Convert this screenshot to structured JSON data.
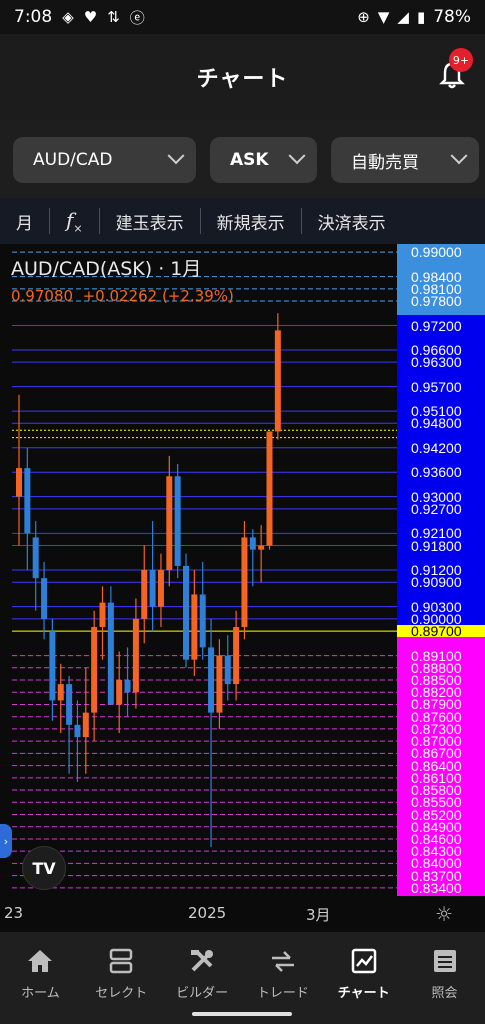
{
  "status": {
    "time": "7:08",
    "battery": "78%"
  },
  "header": {
    "title": "チャート",
    "badge": "9+"
  },
  "selectors": {
    "symbol": "AUD/CAD",
    "side": "ASK",
    "mode": "自動売買"
  },
  "toolbar": {
    "period": "月",
    "fx_label": "f",
    "items": [
      "建玉表示",
      "新規表示",
      "決済表示"
    ]
  },
  "chart_data": {
    "type": "candlestick",
    "title": "AUD/CAD(ASK) · 1月",
    "last_price": "0.97080",
    "change": "+0.02262 (+2.39%)",
    "ylim": [
      0.832,
      0.992
    ],
    "price_labels": [
      "0.99000",
      "0.98400",
      "0.98100",
      "0.97800",
      "0.97200",
      "0.96600",
      "0.96300",
      "0.95700",
      "0.95100",
      "0.94800",
      "0.94200",
      "0.93600",
      "0.93000",
      "0.92700",
      "0.92100",
      "0.91800",
      "0.91200",
      "0.90900",
      "0.90300",
      "0.90000",
      "0.89700",
      "0.89100",
      "0.88800",
      "0.88500",
      "0.88200",
      "0.87900",
      "0.87600",
      "0.87300",
      "0.87000",
      "0.86700",
      "0.86400",
      "0.86100",
      "0.85800",
      "0.85500",
      "0.85200",
      "0.84900",
      "0.84600",
      "0.84300",
      "0.84000",
      "0.83700",
      "0.83400"
    ],
    "candles": [
      {
        "o": 0.93,
        "h": 0.955,
        "l": 0.918,
        "c": 0.937
      },
      {
        "o": 0.937,
        "h": 0.942,
        "l": 0.912,
        "c": 0.921
      },
      {
        "o": 0.92,
        "h": 0.924,
        "l": 0.902,
        "c": 0.91
      },
      {
        "o": 0.91,
        "h": 0.914,
        "l": 0.895,
        "c": 0.9
      },
      {
        "o": 0.897,
        "h": 0.9,
        "l": 0.875,
        "c": 0.88
      },
      {
        "o": 0.88,
        "h": 0.889,
        "l": 0.872,
        "c": 0.884
      },
      {
        "o": 0.884,
        "h": 0.886,
        "l": 0.862,
        "c": 0.874
      },
      {
        "o": 0.874,
        "h": 0.88,
        "l": 0.86,
        "c": 0.871
      },
      {
        "o": 0.871,
        "h": 0.888,
        "l": 0.862,
        "c": 0.877
      },
      {
        "o": 0.877,
        "h": 0.902,
        "l": 0.87,
        "c": 0.898
      },
      {
        "o": 0.898,
        "h": 0.908,
        "l": 0.89,
        "c": 0.904
      },
      {
        "o": 0.904,
        "h": 0.908,
        "l": 0.88,
        "c": 0.879
      },
      {
        "o": 0.879,
        "h": 0.892,
        "l": 0.872,
        "c": 0.885
      },
      {
        "o": 0.885,
        "h": 0.893,
        "l": 0.876,
        "c": 0.882
      },
      {
        "o": 0.882,
        "h": 0.905,
        "l": 0.878,
        "c": 0.9
      },
      {
        "o": 0.9,
        "h": 0.918,
        "l": 0.894,
        "c": 0.912
      },
      {
        "o": 0.912,
        "h": 0.924,
        "l": 0.897,
        "c": 0.903
      },
      {
        "o": 0.903,
        "h": 0.916,
        "l": 0.898,
        "c": 0.912
      },
      {
        "o": 0.912,
        "h": 0.94,
        "l": 0.908,
        "c": 0.935
      },
      {
        "o": 0.935,
        "h": 0.938,
        "l": 0.91,
        "c": 0.913
      },
      {
        "o": 0.913,
        "h": 0.916,
        "l": 0.888,
        "c": 0.89
      },
      {
        "o": 0.89,
        "h": 0.912,
        "l": 0.886,
        "c": 0.906
      },
      {
        "o": 0.906,
        "h": 0.914,
        "l": 0.89,
        "c": 0.893
      },
      {
        "o": 0.893,
        "h": 0.9,
        "l": 0.844,
        "c": 0.877
      },
      {
        "o": 0.877,
        "h": 0.895,
        "l": 0.873,
        "c": 0.891
      },
      {
        "o": 0.891,
        "h": 0.896,
        "l": 0.88,
        "c": 0.884
      },
      {
        "o": 0.884,
        "h": 0.902,
        "l": 0.88,
        "c": 0.898
      },
      {
        "o": 0.898,
        "h": 0.924,
        "l": 0.895,
        "c": 0.92
      },
      {
        "o": 0.92,
        "h": 0.922,
        "l": 0.908,
        "c": 0.917
      },
      {
        "o": 0.917,
        "h": 0.923,
        "l": 0.909,
        "c": 0.918
      },
      {
        "o": 0.918,
        "h": 0.946,
        "l": 0.917,
        "c": 0.946
      },
      {
        "o": 0.946,
        "h": 0.975,
        "l": 0.944,
        "c": 0.9708
      }
    ],
    "x_ticks": [
      "23",
      "2025",
      "3月"
    ],
    "colors": {
      "up": "#f26522",
      "down": "#2f7fd6"
    }
  },
  "nav": [
    {
      "label": "ホーム",
      "icon": "home-icon"
    },
    {
      "label": "セレクト",
      "icon": "select-icon"
    },
    {
      "label": "ビルダー",
      "icon": "builder-icon"
    },
    {
      "label": "トレード",
      "icon": "trade-icon"
    },
    {
      "label": "チャート",
      "icon": "chart-icon"
    },
    {
      "label": "照会",
      "icon": "list-icon"
    }
  ],
  "colors": {
    "blue_zone": "#0000ee",
    "magenta_zone": "#ff00ff",
    "current": "#ffff00",
    "top_zone": "#3c8fdd"
  }
}
